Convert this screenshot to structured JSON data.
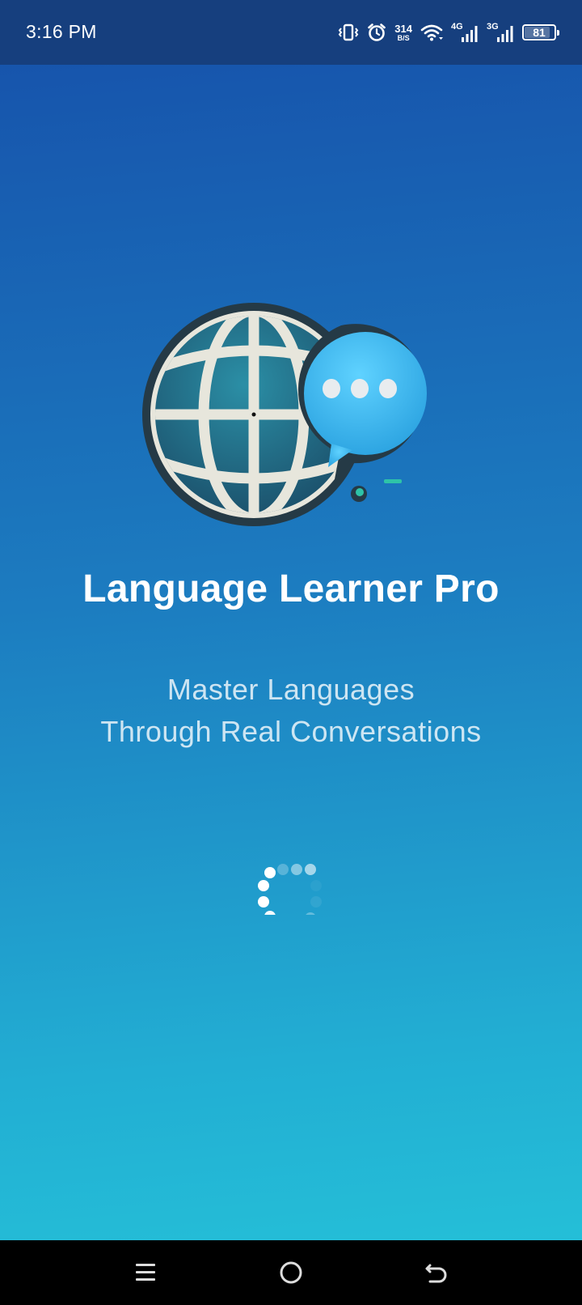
{
  "status_bar": {
    "time": "3:16 PM",
    "net_speed_value": "314",
    "net_speed_unit": "B/S",
    "signal1_label": "4G",
    "signal2_label": "3G",
    "battery": "81",
    "battery_level": 0.81,
    "icons": [
      "vibrate-icon",
      "alarm-icon",
      "wifi-icon",
      "signal-icon",
      "battery-icon"
    ]
  },
  "splash": {
    "app_title": "Language Learner Pro",
    "tagline_line1": "Master Languages",
    "tagline_line2": "Through Real Conversations",
    "logo": "globe-chat-logo",
    "loading_indicator": "spinner"
  },
  "nav_bar": {
    "icons": [
      "menu-icon",
      "home-icon",
      "back-icon"
    ]
  },
  "colors": {
    "gradient_top": "#1650aa",
    "gradient_bottom": "#25c4d9",
    "status_bar": "#163f7e",
    "nav_bar": "#000000",
    "chat_bubble": "#35b6ee"
  }
}
